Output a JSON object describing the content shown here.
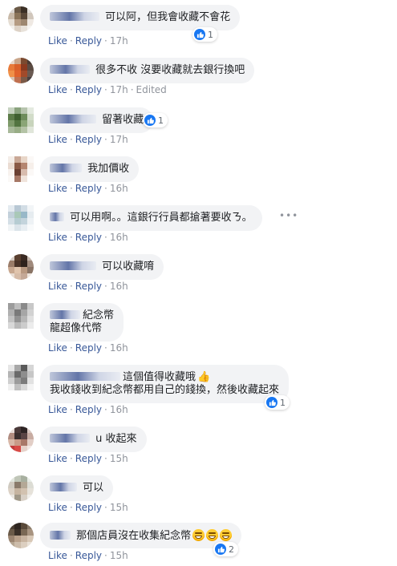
{
  "actions": {
    "like": "Like",
    "reply": "Reply",
    "separator": "·",
    "edited": "Edited"
  },
  "comments": [
    {
      "lines": [
        "可以阿，但我會收藏不會花"
      ],
      "time": "17h",
      "reaction_count": "1"
    },
    {
      "lines": [
        "很多不收 沒要收藏就去銀行換吧"
      ],
      "time": "17h"
    },
    {
      "lines": [
        "留著收藏"
      ],
      "time": "17h",
      "reaction_count": "1"
    },
    {
      "lines": [
        "我加價收"
      ],
      "time": "16h"
    },
    {
      "lines": [
        "可以用啊。。這銀行行員都搶著要收ㄋ。"
      ],
      "time": "16h"
    },
    {
      "lines": [
        "可以收藏唷"
      ],
      "time": "16h"
    },
    {
      "lines": [
        "紀念幣",
        "龍超像代幣"
      ],
      "time": "16h"
    },
    {
      "lines": [
        "這個值得收藏哦",
        "我收錢收到紀念幣都用自己的錢換，然後收藏起來"
      ],
      "time": "16h",
      "reaction_count": "1"
    },
    {
      "lines": [
        "u 收起來"
      ],
      "time": "15h"
    },
    {
      "lines": [
        "可以"
      ],
      "time": "15h"
    },
    {
      "lines": [
        "那個店員沒在收集紀念幣"
      ],
      "time": "15h",
      "reaction_count": "2"
    }
  ],
  "icons": {
    "like_reaction": "like-reaction-icon",
    "more": "more-options-icon",
    "grin": "grinning-face-emoji",
    "thumbs_up": "thumbs-up-emoji"
  },
  "colors": {
    "link": "#385898",
    "meta": "#90949c",
    "bubble": "#f2f3f5",
    "like_blue": "#1877f2"
  }
}
